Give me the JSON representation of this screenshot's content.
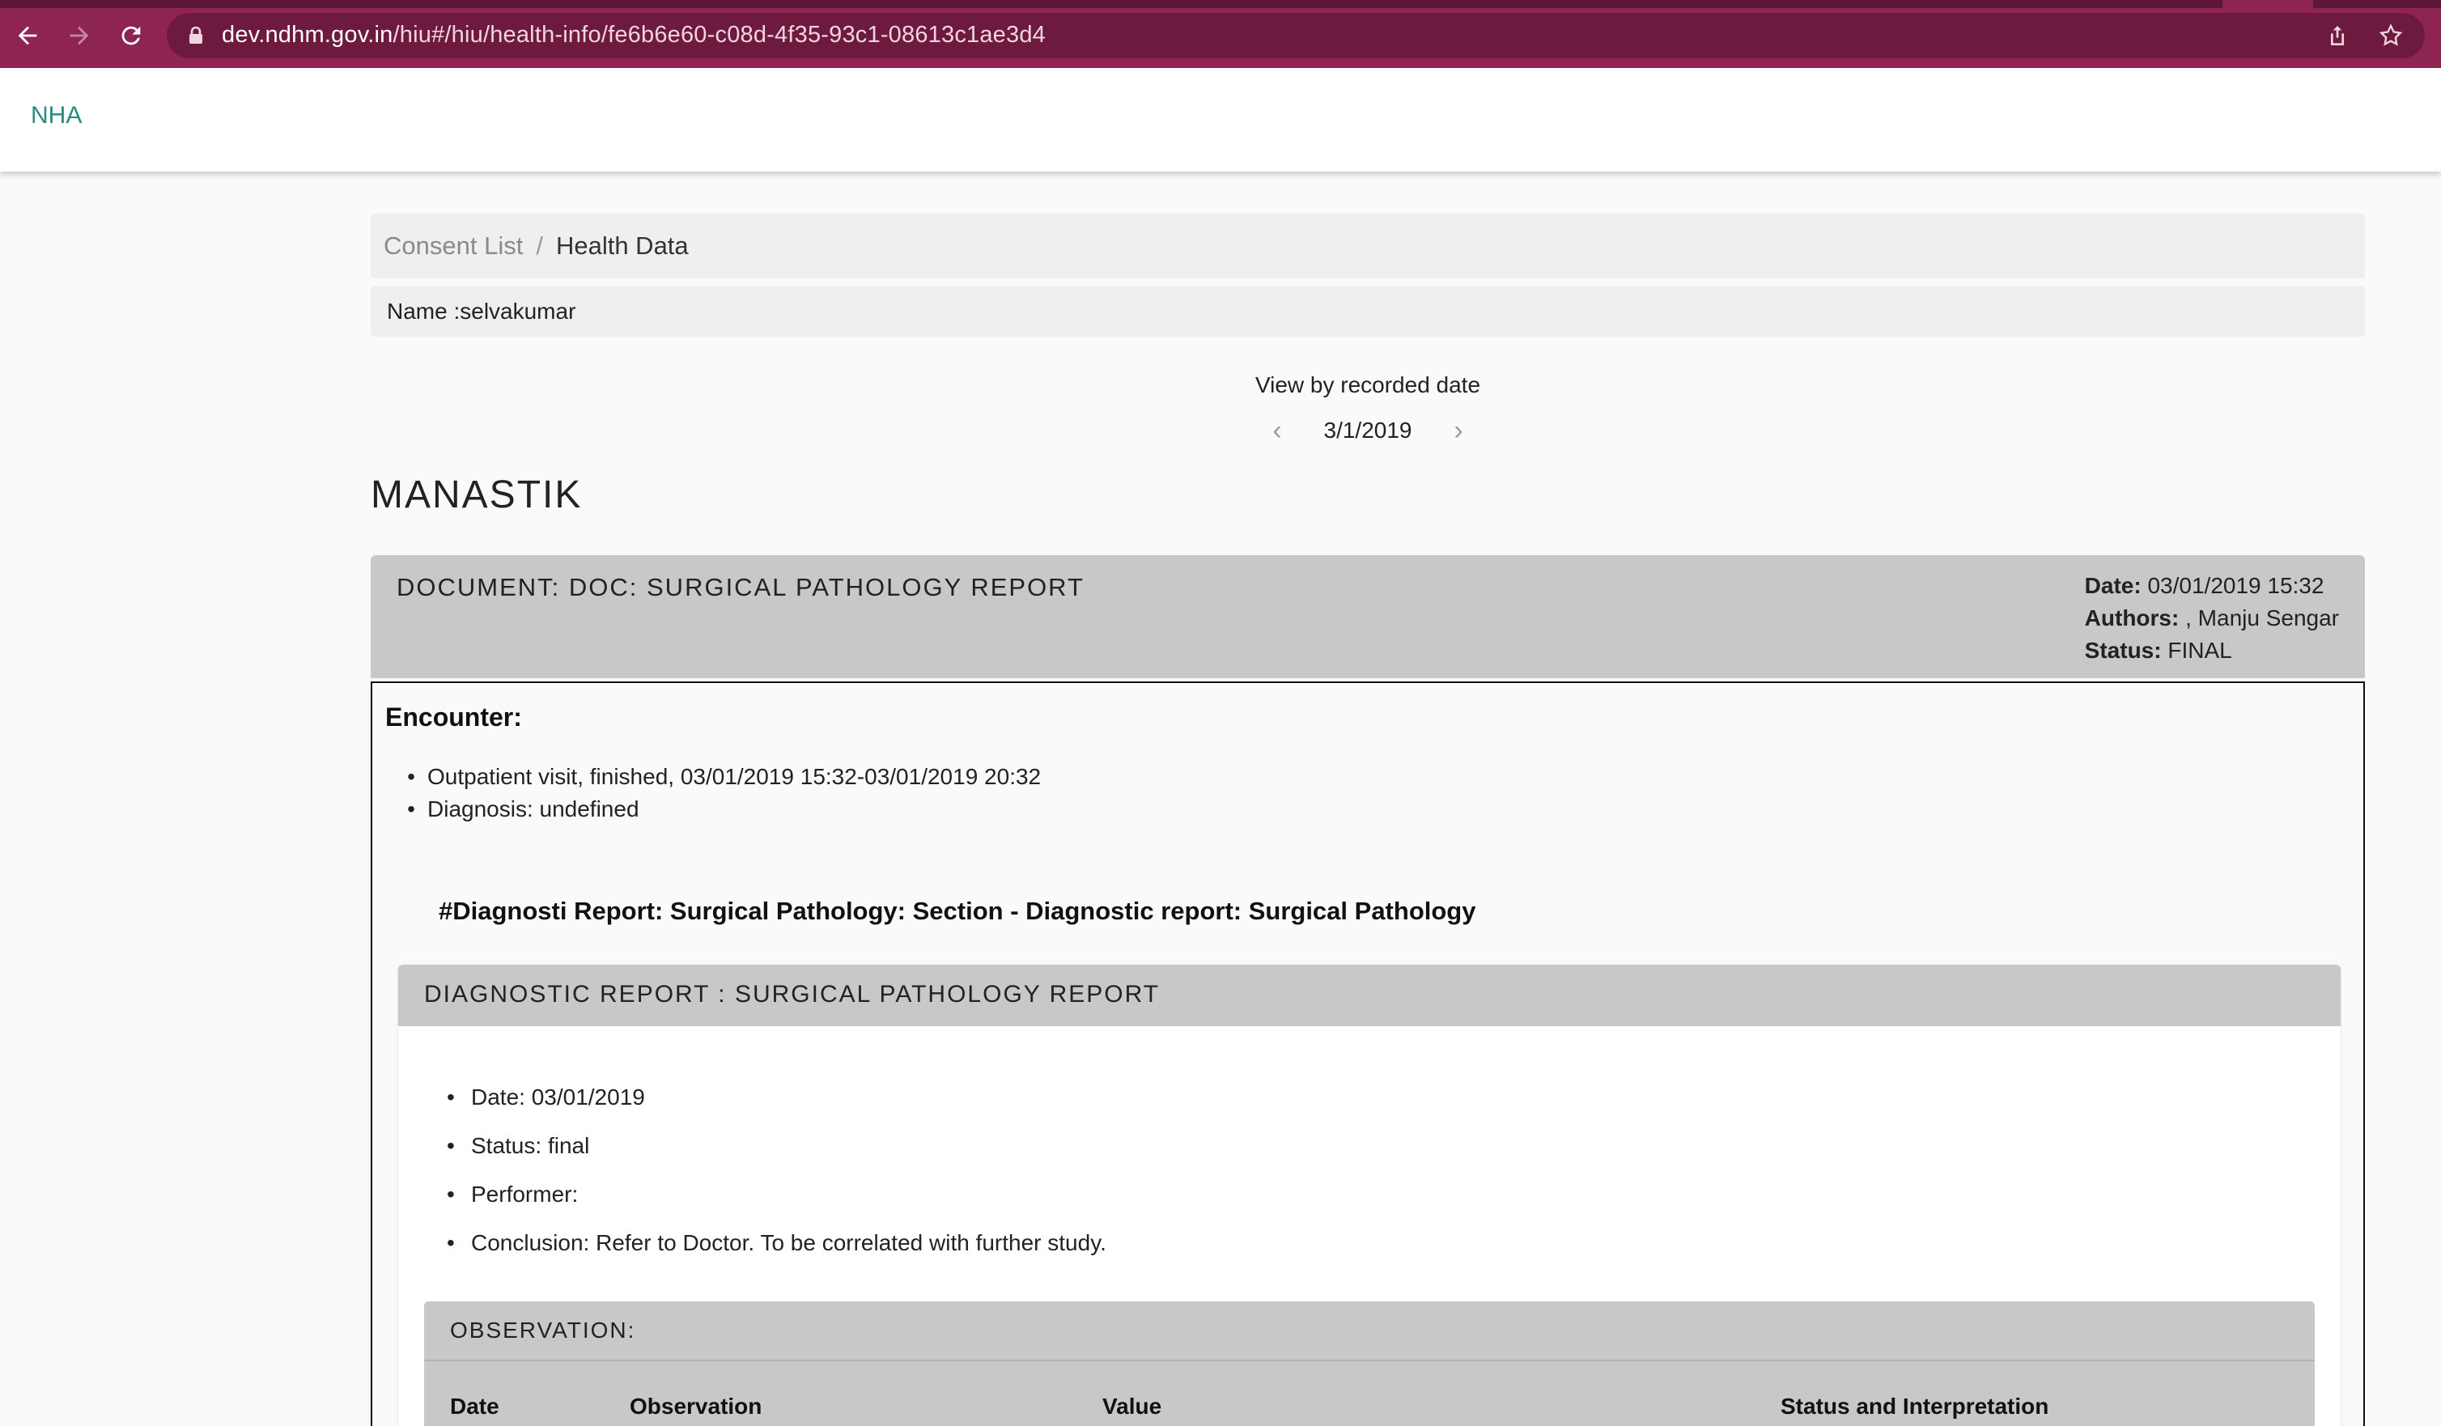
{
  "browser": {
    "url_host": "dev.ndhm.gov.in",
    "url_path": "/hiu#/hiu/health-info/fe6b6e60-c08d-4f35-93c1-08613c1ae3d4",
    "icons": [
      "back-icon",
      "forward-icon",
      "reload-icon",
      "lock-icon",
      "share-icon",
      "star-icon"
    ]
  },
  "app": {
    "brand": "NHA"
  },
  "breadcrumb": {
    "link": "Consent List",
    "separator": "/",
    "current": "Health Data"
  },
  "patient": {
    "name_line": "Name :selvakumar",
    "display_name": "MANASTIK"
  },
  "date_nav": {
    "label": "View by recorded date",
    "date": "3/1/2019",
    "prev": "‹",
    "next": "›"
  },
  "document": {
    "title": "DOCUMENT: DOC: SURGICAL PATHOLOGY REPORT",
    "date_label": "Date:",
    "date_value": " 03/01/2019 15:32",
    "authors_label": "Authors:",
    "authors_value": " , Manju Sengar",
    "status_label": "Status:",
    "status_value": " FINAL"
  },
  "encounter": {
    "label": "Encounter:",
    "items": [
      "Outpatient visit, finished, 03/01/2019 15:32-03/01/2019 20:32",
      "Diagnosis: undefined"
    ]
  },
  "section": {
    "title": "#Diagnosti Report: Surgical Pathology: Section - Diagnostic report: Surgical Pathology"
  },
  "diagnostic_report": {
    "title": "DIAGNOSTIC REPORT : SURGICAL PATHOLOGY REPORT",
    "items": [
      "Date: 03/01/2019",
      "Status: final",
      "Performer:",
      "Conclusion: Refer to Doctor. To be correlated with further study."
    ]
  },
  "observation": {
    "title": "OBSERVATION:",
    "columns": [
      "Date",
      "Observation",
      "Value",
      "Status and Interpretation"
    ]
  },
  "colors": {
    "chrome": "#8e2451",
    "brand": "#2a8a80",
    "card_header": "#c8c8c8"
  }
}
